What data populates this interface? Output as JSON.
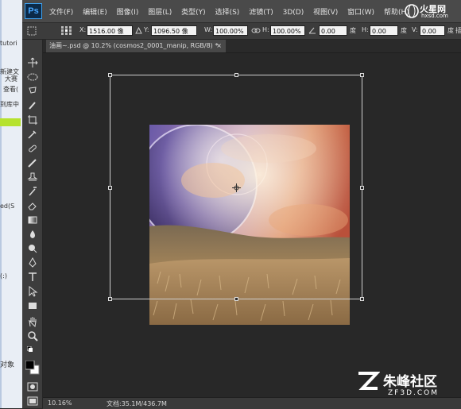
{
  "app": {
    "logo": "Ps"
  },
  "menu": [
    "文件(F)",
    "编辑(E)",
    "图像(I)",
    "图层(L)",
    "类型(Y)",
    "选择(S)",
    "滤镜(T)",
    "3D(D)",
    "视图(V)",
    "窗口(W)",
    "帮助(H)"
  ],
  "options": {
    "x_label": "X:",
    "x_value": "1516.00 像",
    "y_label": "Y:",
    "y_value": "1096.50 像",
    "w_label": "W:",
    "w_value": "100.00%",
    "h_label": "H:",
    "h_value": "100.00%",
    "angle_value": "0.00",
    "angle_unit": "度",
    "hskew_label": "H:",
    "hskew_value": "0.00",
    "hskew_unit": "度",
    "vskew_label": "V:",
    "vskew_value": "0.00",
    "vskew_unit": "度",
    "interp_label": "插图"
  },
  "document_tab": {
    "title": "油画~.psd @ 10.2% (cosmos2_0001_manip, RGB/8) *",
    "close": "×"
  },
  "status": {
    "zoom": "10.16%",
    "doc_size": "文档:35.1M/436.7M"
  },
  "background_window": [
    "tutori",
    "新建文",
    "大赛",
    "查看(",
    "到库中",
    "ed(S",
    "(:)",
    "对象"
  ],
  "watermarks": {
    "top_text": "火星网",
    "top_sub": "hxsd.com",
    "bottom_text": "朱峰社区",
    "bottom_sub": "ZF3D.COM"
  },
  "tools": [
    "move-tool",
    "marquee-tool",
    "lasso-tool",
    "quick-select-tool",
    "crop-tool",
    "eyedropper-tool",
    "healing-tool",
    "brush-tool",
    "clone-stamp-tool",
    "history-brush-tool",
    "eraser-tool",
    "gradient-tool",
    "blur-tool",
    "dodge-tool",
    "pen-tool",
    "type-tool",
    "path-select-tool",
    "shape-tool",
    "hand-tool",
    "zoom-tool",
    "foreground-background-colors",
    "quick-mask-mode",
    "screen-mode"
  ],
  "colors": {
    "menubar": "#4a4a4a",
    "workspace": "#282828",
    "ps_blue": "#47a7ff"
  }
}
